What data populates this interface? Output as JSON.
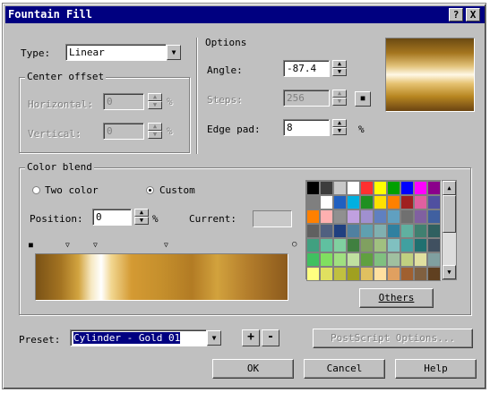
{
  "window": {
    "title": "Fountain Fill",
    "help_btn": "?",
    "close_btn": "X"
  },
  "type": {
    "label": "Type:",
    "value": "Linear"
  },
  "center_offset": {
    "title": "Center offset",
    "horizontal_label": "Horizontal:",
    "horizontal_value": "0",
    "vertical_label": "Vertical:",
    "vertical_value": "0",
    "unit": "%"
  },
  "options": {
    "title": "Options",
    "angle_label": "Angle:",
    "angle_value": "-87.4",
    "steps_label": "Steps:",
    "steps_value": "256",
    "lock_icon": "lock-icon",
    "edge_pad_label": "Edge pad:",
    "edge_pad_value": "8",
    "edge_pad_unit": "%"
  },
  "color_blend": {
    "title": "Color blend",
    "two_color_label": "Two color",
    "custom_label": "Custom",
    "selected": "Custom",
    "position_label": "Position:",
    "position_value": "0",
    "position_unit": "%",
    "current_label": "Current:",
    "others_button": "Others"
  },
  "palette": {
    "colors": [
      "#000000",
      "#3c3c3c",
      "#c8c8c8",
      "#ffffff",
      "#ff3030",
      "#ffff00",
      "#00a000",
      "#0000ff",
      "#ff00ff",
      "#8b008b",
      "#7f7f7f",
      "#ffffff",
      "#2060c0",
      "#00b0e0",
      "#209020",
      "#ffe000",
      "#ff8000",
      "#a02020",
      "#e060a0",
      "#5050a0",
      "#ff8000",
      "#ffb0b0",
      "#909090",
      "#c0a0e0",
      "#a090d0",
      "#6080c0",
      "#60a0c0",
      "#707070",
      "#8060a0",
      "#4060a0",
      "#606060",
      "#506080",
      "#204080",
      "#5080a0",
      "#60a0b0",
      "#80b0b0",
      "#3080a0",
      "#60b0a0",
      "#408070",
      "#306060",
      "#40a080",
      "#60c0a0",
      "#80d0a0",
      "#408040",
      "#80a060",
      "#a0c080",
      "#80c0c0",
      "#40a0a0",
      "#207070",
      "#405060",
      "#40c060",
      "#80e060",
      "#a0e080",
      "#c0e0a0",
      "#60a040",
      "#80c080",
      "#a0c0a0",
      "#c0d080",
      "#e0e0a0",
      "#80a0a0",
      "#ffff80",
      "#e0e060",
      "#c0c040",
      "#a0a020",
      "#e0c060",
      "#ffe0a0",
      "#e0a060",
      "#a06030",
      "#806040",
      "#604020"
    ]
  },
  "preset": {
    "label": "Preset:",
    "value": "Cylinder - Gold 01",
    "add": "+",
    "remove": "-"
  },
  "buttons": {
    "postscript": "PostScript Options...",
    "ok": "OK",
    "cancel": "Cancel",
    "help": "Help"
  }
}
